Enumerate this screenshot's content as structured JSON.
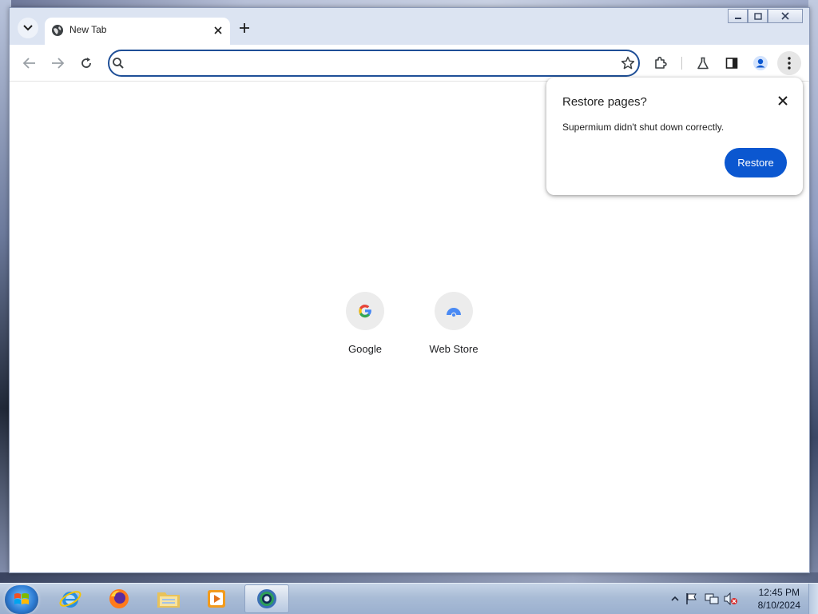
{
  "browser": {
    "tab": {
      "title": "New Tab"
    },
    "omnibox": {
      "value": "",
      "placeholder": ""
    },
    "new_tab_page": {
      "shortcuts": [
        {
          "label": "Google",
          "icon": "google-g-icon"
        },
        {
          "label": "Web Store",
          "icon": "web-store-icon"
        }
      ]
    },
    "restore_bubble": {
      "title": "Restore pages?",
      "message": "Supermium didn't shut down correctly.",
      "button_label": "Restore"
    },
    "colors": {
      "accent": "#0b57d0",
      "omnibox_border": "#1f4f97"
    }
  },
  "taskbar": {
    "apps": [
      "internet-explorer-icon",
      "firefox-icon",
      "file-explorer-icon",
      "media-player-icon",
      "supermium-icon"
    ],
    "clock": {
      "time": "12:45 PM",
      "date": "8/10/2024"
    }
  }
}
